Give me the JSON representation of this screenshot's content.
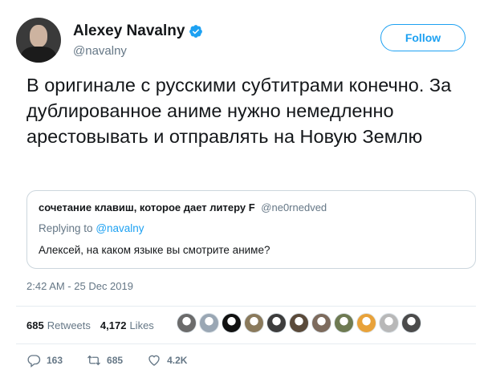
{
  "author": {
    "name": "Alexey Navalny",
    "handle": "@navalny"
  },
  "follow_label": "Follow",
  "tweet_text": "В оригинале с русскими субтитрами конечно. За дублированное аниме нужно немедленно арестовывать и отправлять на Новую Землю",
  "quote": {
    "author": "сочетание клавиш, которое дает литеру F",
    "handle": "@ne0rnedved",
    "reply_prefix": "Replying to",
    "reply_to": "@navalny",
    "text": "Алексей, на каком языке вы смотрите аниме?"
  },
  "timestamp": "2:42 AM - 25 Dec 2019",
  "stats": {
    "retweets_count": "685",
    "retweets_label": "Retweets",
    "likes_count": "4,172",
    "likes_label": "Likes"
  },
  "actions": {
    "reply_count": "163",
    "retweet_count": "685",
    "like_count": "4.2K"
  },
  "colors": {
    "accent": "#1da1f2",
    "text": "#14171a",
    "muted": "#657786",
    "border": "#ccd6dd"
  },
  "icons": [
    "verified-badge-icon",
    "reply-icon",
    "retweet-icon",
    "like-icon"
  ],
  "liker_avatar_colors": [
    "#6b6b6b",
    "#9aa7b4",
    "#111111",
    "#8a7a5c",
    "#3d3d3d",
    "#5a4a3a",
    "#7d6b5d",
    "#6e7a52",
    "#e8a23a",
    "#b8b8b8",
    "#4b4b4b"
  ]
}
